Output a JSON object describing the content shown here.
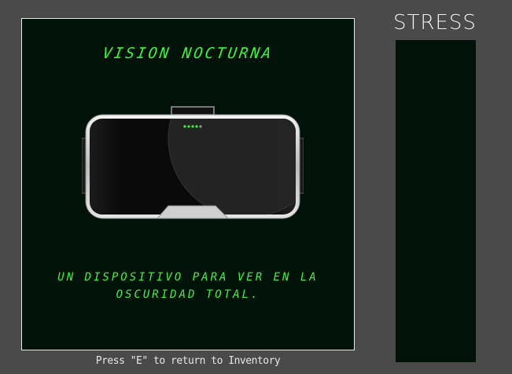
{
  "item": {
    "title": "VISION NOCTURNA",
    "description_line1": "UN DISPOSITIVO PARA VER EN LA",
    "description_line2": "OSCURIDAD TOTAL.",
    "icon": "night-vision-goggles-icon"
  },
  "hint": {
    "text": "Press \"E\" to return to Inventory"
  },
  "stress": {
    "label": "STRESS",
    "level": 0
  },
  "colors": {
    "background": "#4a4a4a",
    "panel": "#011208",
    "accent_green": "#3df23d",
    "border": "#e8e8e8"
  }
}
